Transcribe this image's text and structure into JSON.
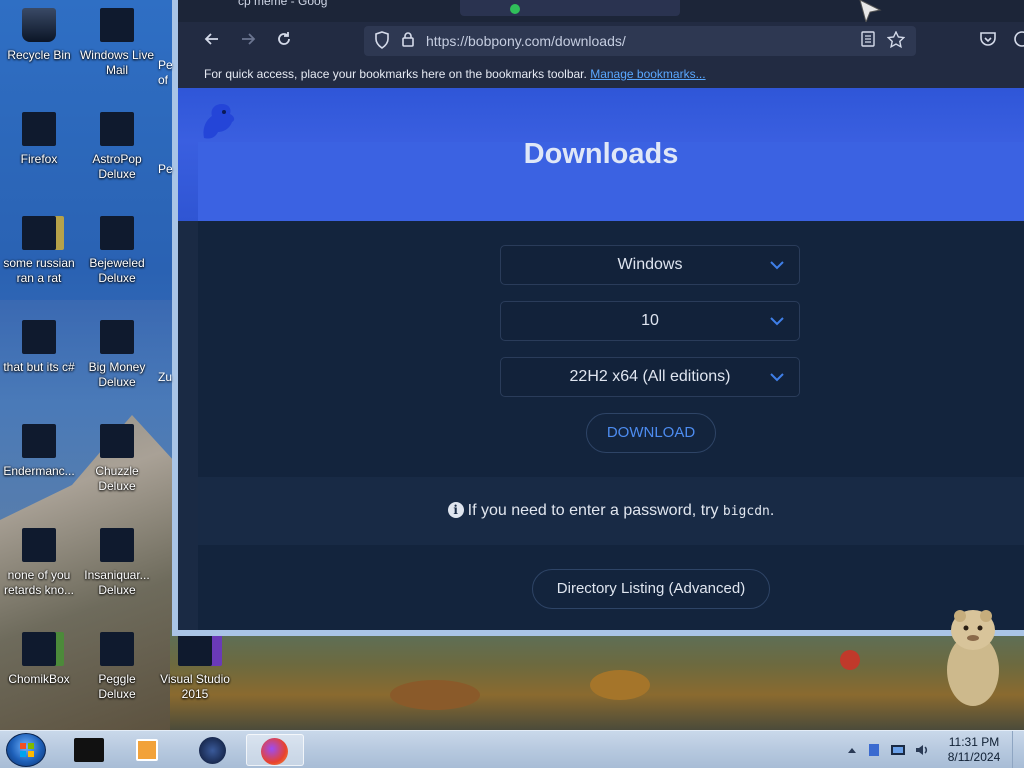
{
  "desktop": {
    "icons": [
      {
        "label": "Recycle Bin",
        "col": 0,
        "row": 0
      },
      {
        "label": "Windows Live Mail",
        "col": 1,
        "row": 0
      },
      {
        "label": "Firefox",
        "col": 0,
        "row": 1
      },
      {
        "label": "AstroPop Deluxe",
        "col": 1,
        "row": 1
      },
      {
        "label": "some russian ran a rat",
        "col": 0,
        "row": 2
      },
      {
        "label": "Bejeweled Deluxe",
        "col": 1,
        "row": 2
      },
      {
        "label": "that but its c#",
        "col": 0,
        "row": 3
      },
      {
        "label": "Big Money Deluxe",
        "col": 1,
        "row": 3
      },
      {
        "label": "Endermanc...",
        "col": 0,
        "row": 4
      },
      {
        "label": "Chuzzle Deluxe",
        "col": 1,
        "row": 4
      },
      {
        "label": "none of you retards kno...",
        "col": 0,
        "row": 5
      },
      {
        "label": "Insaniquar... Deluxe",
        "col": 1,
        "row": 5
      },
      {
        "label": "ChomikBox",
        "col": 0,
        "row": 6
      },
      {
        "label": "Peggle Deluxe",
        "col": 1,
        "row": 6
      },
      {
        "label": "Visual Studio 2015",
        "col": 2,
        "row": 6
      }
    ],
    "partial_labels": [
      "Pe of",
      "Pe",
      "Zu"
    ]
  },
  "browser": {
    "tab_fragment": "cp meme - Goog",
    "url": "https://bobpony.com/downloads/",
    "bookmarks_hint": "For quick access, place your bookmarks here on the bookmarks toolbar.",
    "bookmarks_link": "Manage bookmarks..."
  },
  "page": {
    "title": "Downloads",
    "os_select": "Windows",
    "version_select": "10",
    "build_select": "22H2 x64 (All editions)",
    "download_label": "DOWNLOAD",
    "password_prefix": "If you need to enter a password, try ",
    "password_value": "bigcdn",
    "password_suffix": ".",
    "directory_label": "Directory Listing (Advanced)"
  },
  "taskbar": {
    "time": "11:31 PM",
    "date": "8/11/2024"
  },
  "colors": {
    "accent_blue": "#3b62e2",
    "link_blue": "#4d8cf0",
    "page_bg": "#13243d"
  }
}
